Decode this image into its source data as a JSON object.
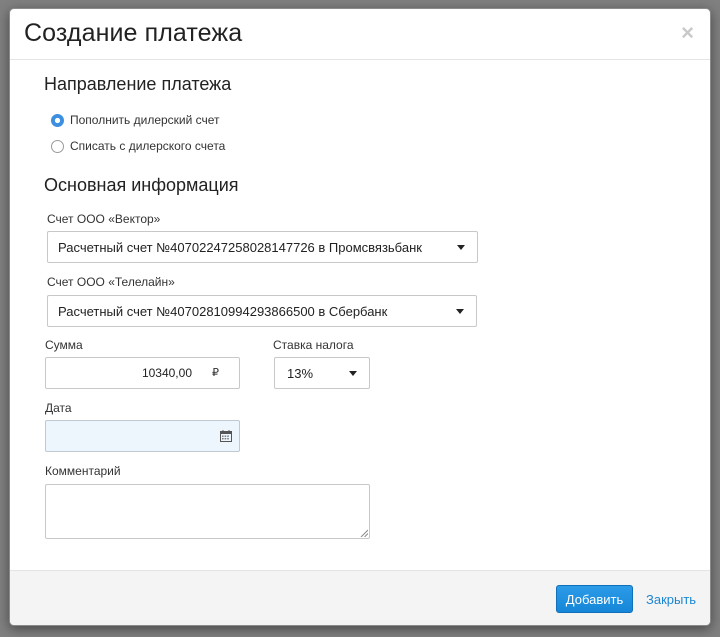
{
  "dialog": {
    "title": "Создание платежа",
    "close_glyph": "×"
  },
  "direction": {
    "heading": "Направление платежа",
    "options": [
      {
        "label": "Пополнить дилерский счет",
        "checked": true
      },
      {
        "label": "Списать с дилерского счета",
        "checked": false
      }
    ]
  },
  "main_info": {
    "heading": "Основная информация",
    "account_vector": {
      "label": "Счет ООО «Вектор»",
      "value": "Расчетный счет №40702247258028147726 в Промсвязьбанк"
    },
    "account_teleline": {
      "label": "Счет ООО «Телелайн»",
      "value": "Расчетный счет №40702810994293866500 в Сбербанк"
    },
    "sum": {
      "label": "Сумма",
      "value": "10340,00",
      "currency": "₽"
    },
    "tax_rate": {
      "label": "Ставка налога",
      "value": "13%"
    },
    "date": {
      "label": "Дата",
      "value": ""
    },
    "comment": {
      "label": "Комментарий",
      "value": ""
    }
  },
  "footer": {
    "add_label": "Добавить",
    "close_label": "Закрыть"
  },
  "icons": {
    "close": "close-icon",
    "calendar": "calendar-icon",
    "dropdown": "chevron-down-icon"
  },
  "colors": {
    "accent": "#1586d8",
    "link": "#1d86d0",
    "date_field_bg": "#eef6fd"
  }
}
